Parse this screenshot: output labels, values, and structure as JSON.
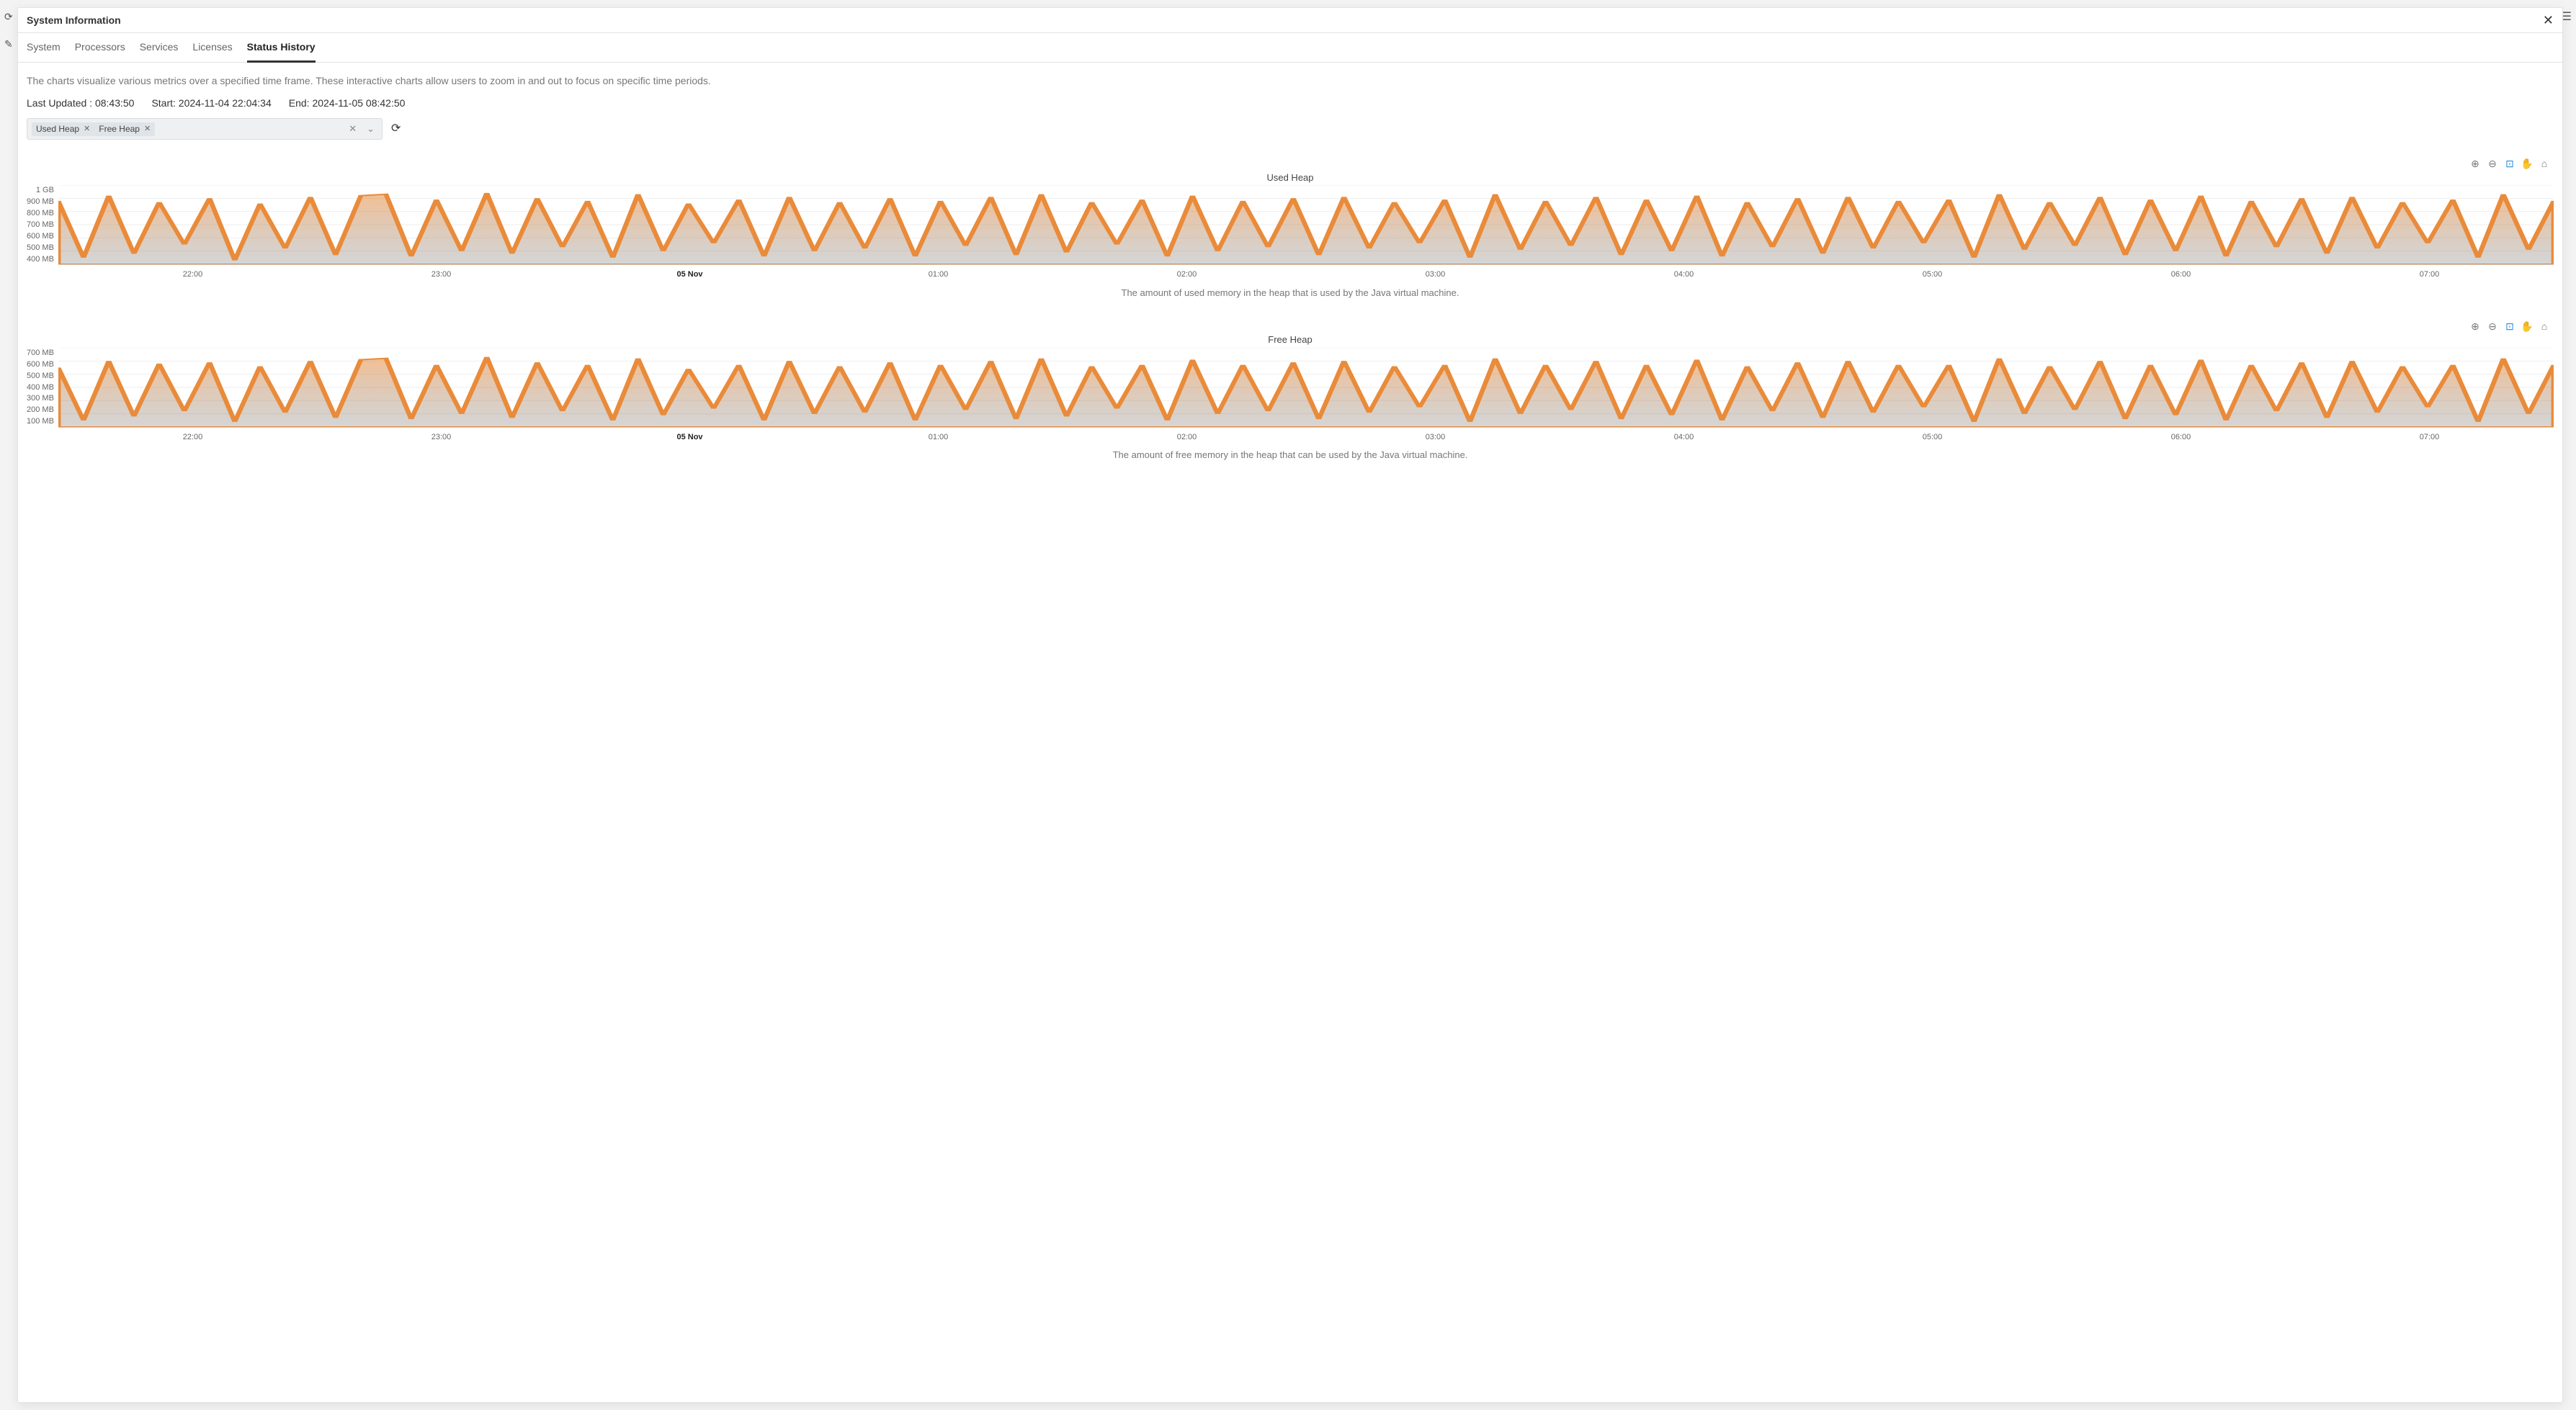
{
  "modal": {
    "title": "System Information",
    "tabs": [
      "System",
      "Processors",
      "Services",
      "Licenses",
      "Status History"
    ],
    "activeTab": "Status History",
    "description": "The charts visualize various metrics over a specified time frame. These interactive charts allow users to zoom in and out to focus on specific time periods.",
    "lastUpdated": "Last Updated : 08:43:50",
    "start": "Start: 2024-11-04 22:04:34",
    "end": "End: 2024-11-05 08:42:50",
    "chips": [
      "Used Heap",
      "Free Heap"
    ]
  },
  "xticks": [
    "22:00",
    "23:00",
    "05 Nov",
    "01:00",
    "02:00",
    "03:00",
    "04:00",
    "05:00",
    "06:00",
    "07:00"
  ],
  "chart_data": [
    {
      "type": "area",
      "title": "Used Heap",
      "description": "The amount of used memory in the heap that is used by the Java virtual machine.",
      "ylabel": "",
      "yticks": [
        "1 GB",
        "900 MB",
        "800 MB",
        "700 MB",
        "600 MB",
        "500 MB",
        "400 MB"
      ],
      "ylim_mb": [
        400,
        1000
      ],
      "x": [
        "22:00",
        "23:00",
        "05 Nov",
        "01:00",
        "02:00",
        "03:00",
        "04:00",
        "05:00",
        "06:00",
        "07:00"
      ],
      "values_mb": [
        880,
        450,
        920,
        480,
        870,
        550,
        900,
        430,
        860,
        520,
        910,
        470,
        920,
        930,
        460,
        890,
        500,
        940,
        480,
        900,
        530,
        880,
        450,
        930,
        500,
        860,
        560,
        890,
        460,
        910,
        500,
        870,
        520,
        900,
        460,
        880,
        540,
        910,
        470,
        930,
        490,
        870,
        550,
        890,
        460,
        920,
        500,
        880,
        530,
        900,
        470,
        910,
        520,
        870,
        560,
        890,
        450,
        930,
        510,
        880,
        540,
        910,
        470,
        890,
        500,
        920,
        460,
        870,
        530,
        900,
        480,
        910,
        520,
        880,
        560,
        890,
        450,
        930,
        510,
        870,
        540,
        910,
        470,
        890,
        500,
        920,
        460,
        880,
        530,
        900,
        480,
        910,
        520,
        870,
        560,
        890,
        450,
        930,
        510,
        880
      ],
      "color": "#E98B3A"
    },
    {
      "type": "area",
      "title": "Free Heap",
      "description": "The amount of free memory in the heap that can be used by the Java virtual machine.",
      "ylabel": "",
      "yticks": [
        "700 MB",
        "600 MB",
        "500 MB",
        "400 MB",
        "300 MB",
        "200 MB",
        "100 MB"
      ],
      "ylim_mb": [
        100,
        700
      ],
      "x": [
        "22:00",
        "23:00",
        "05 Nov",
        "01:00",
        "02:00",
        "03:00",
        "04:00",
        "05:00",
        "06:00",
        "07:00"
      ],
      "values_mb": [
        550,
        150,
        600,
        180,
        580,
        220,
        590,
        140,
        560,
        210,
        600,
        170,
        610,
        620,
        160,
        570,
        200,
        630,
        170,
        590,
        220,
        570,
        150,
        620,
        190,
        540,
        240,
        570,
        150,
        600,
        200,
        560,
        210,
        590,
        150,
        570,
        230,
        600,
        160,
        620,
        180,
        560,
        240,
        570,
        150,
        610,
        200,
        570,
        220,
        590,
        160,
        600,
        210,
        560,
        250,
        570,
        140,
        620,
        200,
        570,
        230,
        600,
        160,
        570,
        190,
        610,
        150,
        560,
        220,
        590,
        170,
        600,
        210,
        570,
        250,
        570,
        140,
        620,
        200,
        560,
        230,
        600,
        160,
        570,
        190,
        610,
        150,
        570,
        220,
        590,
        170,
        600,
        210,
        560,
        250,
        570,
        140,
        620,
        200,
        570
      ],
      "color": "#E98B3A"
    }
  ]
}
